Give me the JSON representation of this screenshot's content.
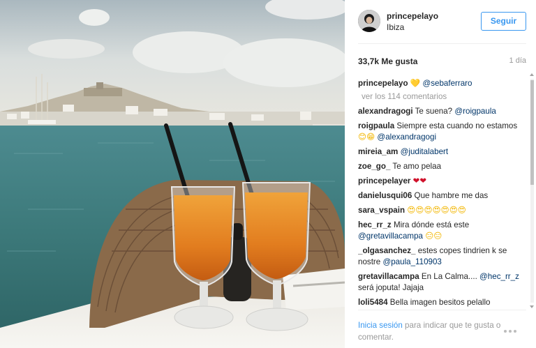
{
  "header": {
    "username": "princepelayo",
    "location": "Ibiza",
    "follow_label": "Seguir"
  },
  "stats": {
    "likes": "33,7k Me gusta",
    "time_ago": "1 día"
  },
  "caption": {
    "user": "princepelayo",
    "heart": "💛",
    "mention": "@sebaferraro"
  },
  "load_more": "ver los 114 comentarios",
  "comments": [
    {
      "user": "alexandragogi",
      "text": "Te suena?",
      "mention": "@roigpaula"
    },
    {
      "user": "roigpaula",
      "text": "Siempre esta cuando no estamos",
      "emoji": "😊😁",
      "mention": "@alexandragogi"
    },
    {
      "user": "mireia_am",
      "text": "",
      "mention": "@juditalabert"
    },
    {
      "user": "zoe_go_",
      "text": "Te amo pelaa"
    },
    {
      "user": "princepelayer",
      "emoji": "❤❤"
    },
    {
      "user": "danielusqui06",
      "text": "Que hambre me das"
    },
    {
      "user": "sara_vspain",
      "emoji": "😍😍😍😍😍😍😍"
    },
    {
      "user": "hec_rr_z",
      "text": "Mira dónde está este",
      "mention": "@gretavillacampa",
      "emoji": "😑😑"
    },
    {
      "user": "_olgasanchez_",
      "text": "estes copes tindrien k se nostre",
      "mention": "@paula_110903"
    },
    {
      "user": "gretavillacampa",
      "text": "En La Calma....",
      "mention": "@hec_rr_z",
      "after": "será joputa! Jajaja"
    },
    {
      "user": "loli5484",
      "text": "Bella imagen besitos pelallo"
    }
  ],
  "footer": {
    "login_label": "Inicia sesión",
    "prompt": "para indicar que te gusta o comentar."
  },
  "colors": {
    "link_blue": "#3897f0",
    "mention_navy": "#003569",
    "muted_gray": "#999999"
  }
}
